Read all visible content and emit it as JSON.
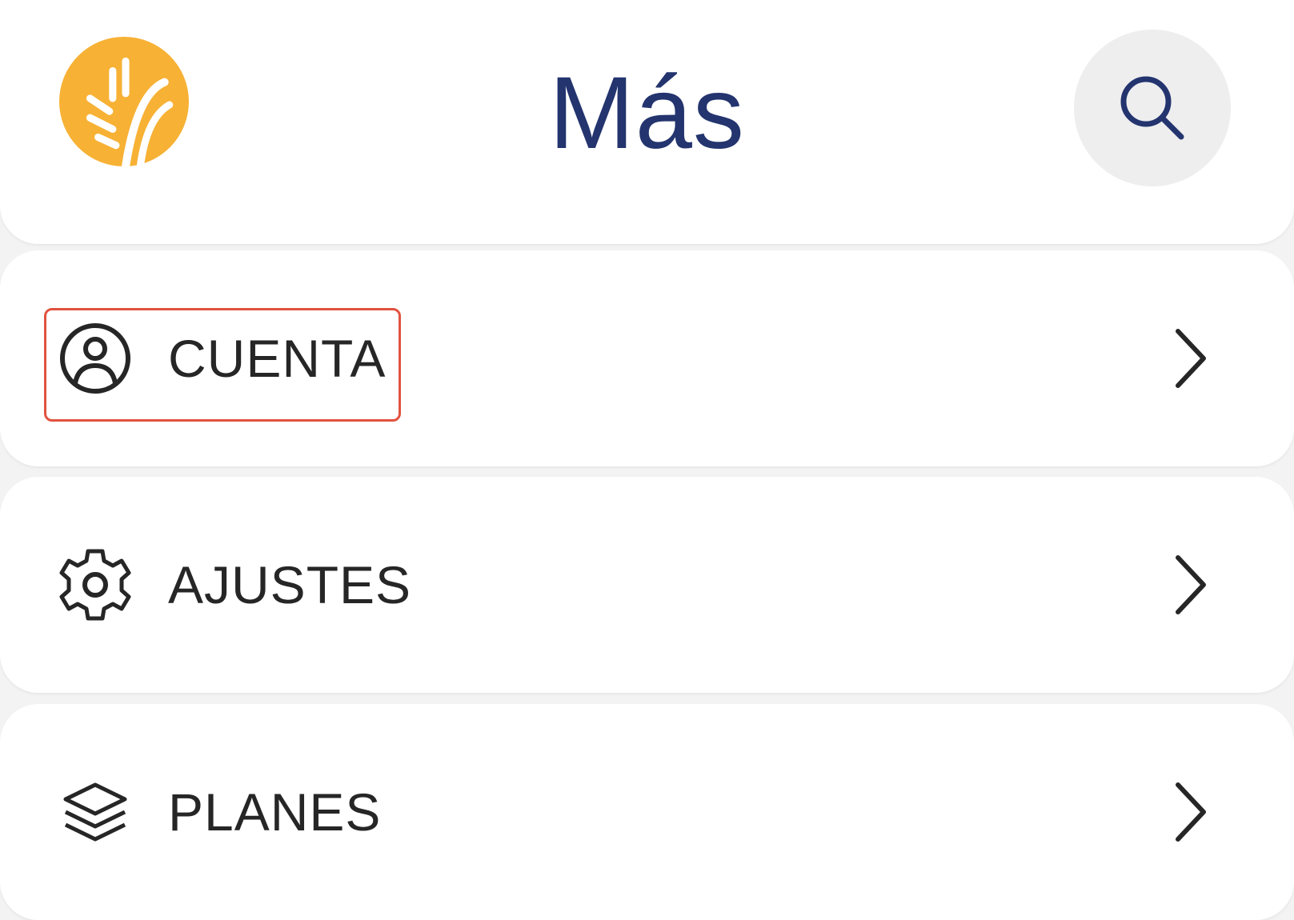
{
  "header": {
    "title": "Más",
    "logo_icon": "wheat-logo-icon",
    "search_icon": "search-icon"
  },
  "menu": {
    "items": [
      {
        "label": "CUENTA",
        "icon": "user-circle-icon"
      },
      {
        "label": "AJUSTES",
        "icon": "gear-icon"
      },
      {
        "label": "PLANES",
        "icon": "layers-icon"
      }
    ]
  },
  "colors": {
    "brand_orange": "#f7b134",
    "title_navy": "#23346e",
    "highlight_red": "#e2523f"
  }
}
